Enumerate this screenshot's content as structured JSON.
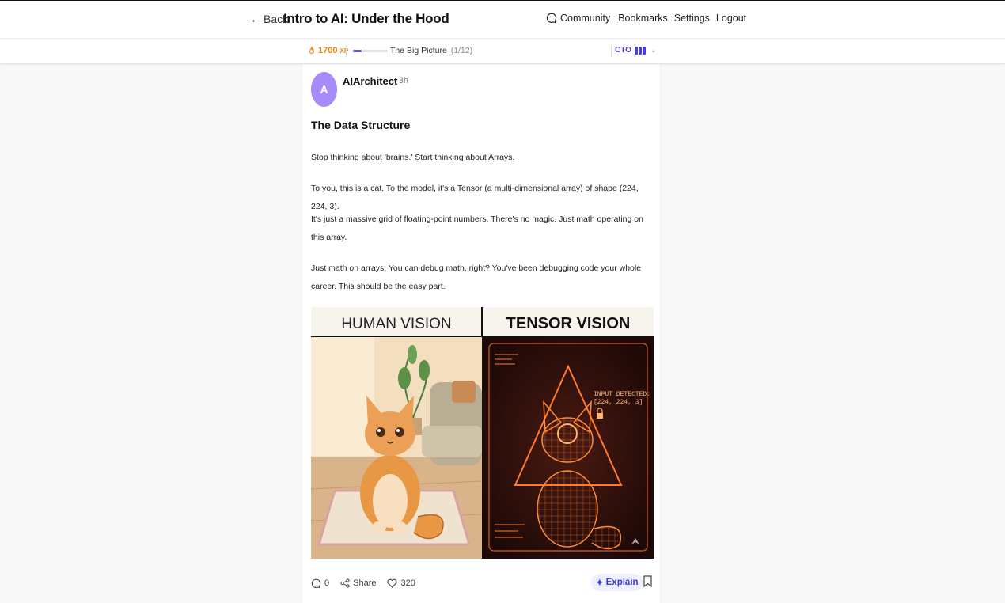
{
  "header": {
    "back_label": "Back",
    "course_title": "Intro to AI: Under the Hood",
    "nav": {
      "community": "Community",
      "bookmarks": "Bookmarks",
      "settings": "Settings",
      "logout": "Logout"
    }
  },
  "progress_bar": {
    "xp_value": "1700",
    "xp_unit": "XP",
    "lesson_progress": 0.25,
    "lesson_title": "The Big Picture",
    "lesson_count": "(1/12)",
    "role": "CTO"
  },
  "post": {
    "avatar_letter": "A",
    "author": "AIArchitect",
    "time": "· 3h",
    "title": "The Data Structure",
    "paragraphs": [
      "Stop thinking about 'brains.' Start thinking about Arrays.",
      "To you, this is a cat. To the model, it's a Tensor (a multi-dimensional array) of shape (224, 224, 3).",
      "It's just a massive grid of floating-point numbers. There's no magic. Just math operating on this array.",
      "Just math on arrays. You can debug math, right? You've been debugging code your whole career. This should be the easy part."
    ],
    "figure": {
      "left_heading": "HUMAN VISION",
      "right_heading": "TENSOR VISION",
      "overlay_line1": "INPUT DETECTED:",
      "overlay_line2": "[224, 224, 3]"
    },
    "actions": {
      "comments": "0",
      "share": "Share",
      "likes": "320",
      "explain": "Explain"
    }
  },
  "colors": {
    "accent": "#4b3fd8",
    "xp": "#e8870c",
    "avatar": "#a78bfa"
  }
}
